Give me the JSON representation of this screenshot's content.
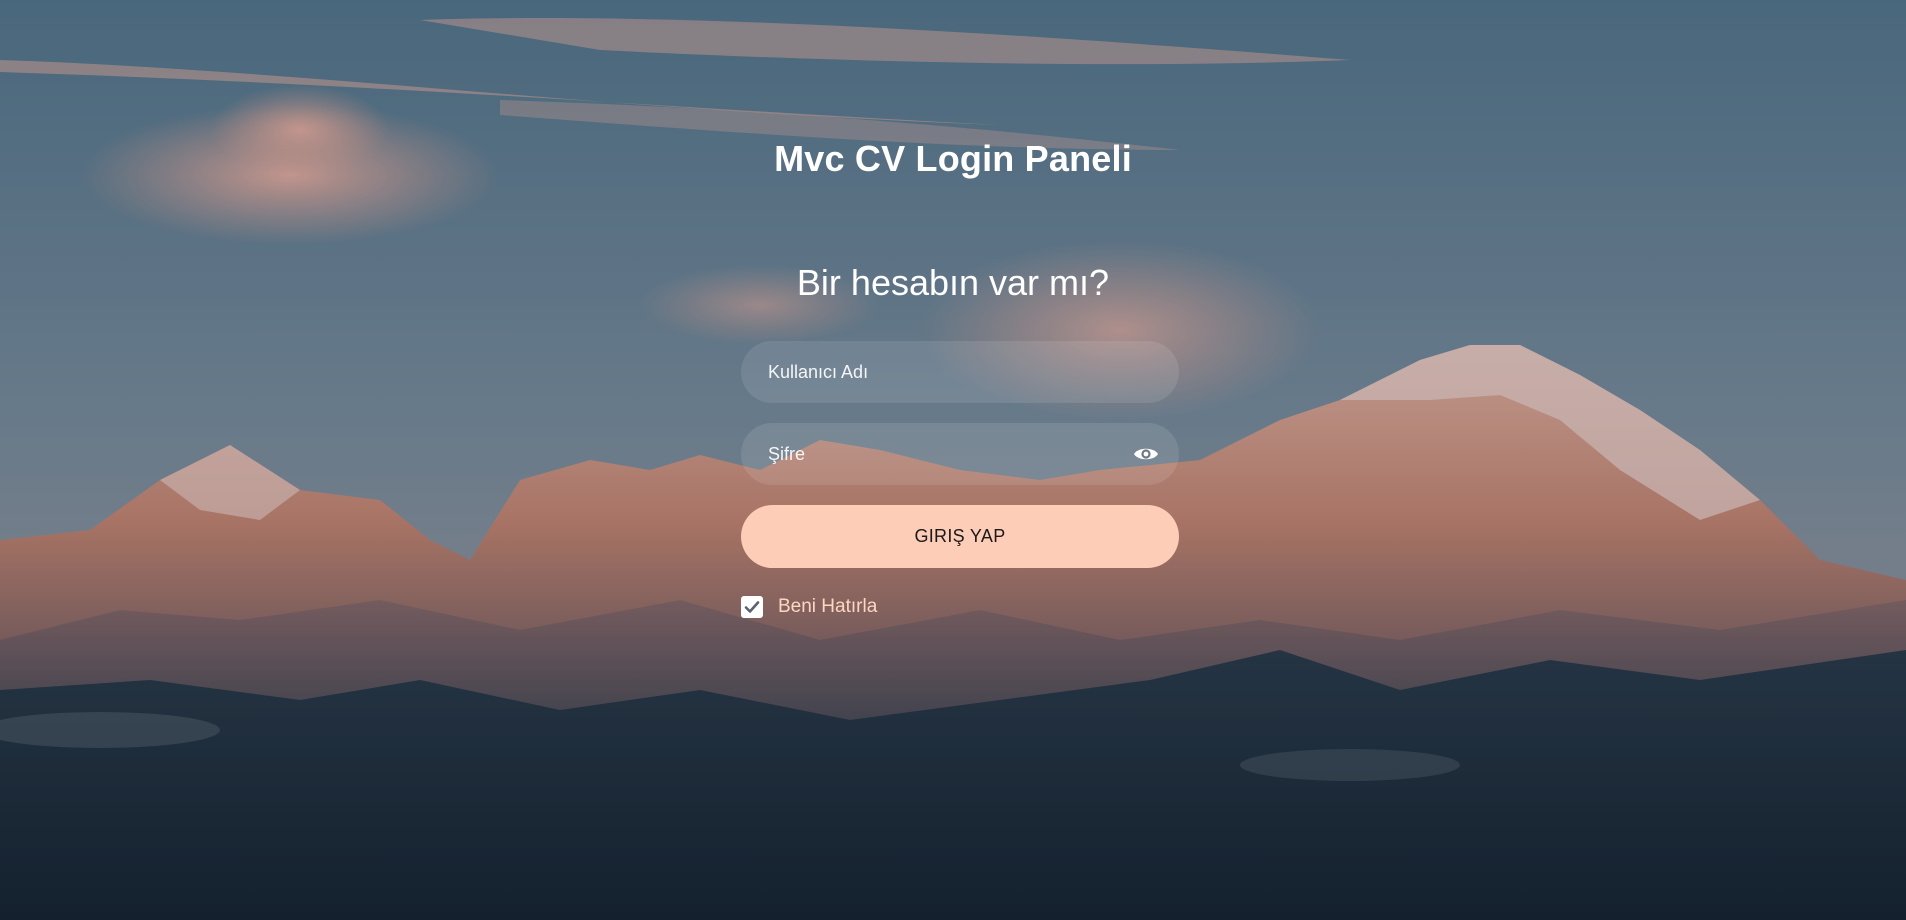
{
  "page": {
    "title": "Mvc CV Login Paneli",
    "subtitle": "Bir hesabın var mı?"
  },
  "form": {
    "username_placeholder": "Kullanıcı Adı",
    "username_value": "",
    "password_placeholder": "Şifre",
    "password_value": "",
    "show_password_icon": "eye-icon",
    "submit_label": "GIRIŞ YAP",
    "remember_label": "Beni Hatırla",
    "remember_checked": true
  },
  "colors": {
    "button_bg": "#fdcdb7",
    "remember_text": "#fdd6c2",
    "title_text": "#ffffff"
  },
  "background": {
    "description_icon": "mountain-landscape-image"
  }
}
